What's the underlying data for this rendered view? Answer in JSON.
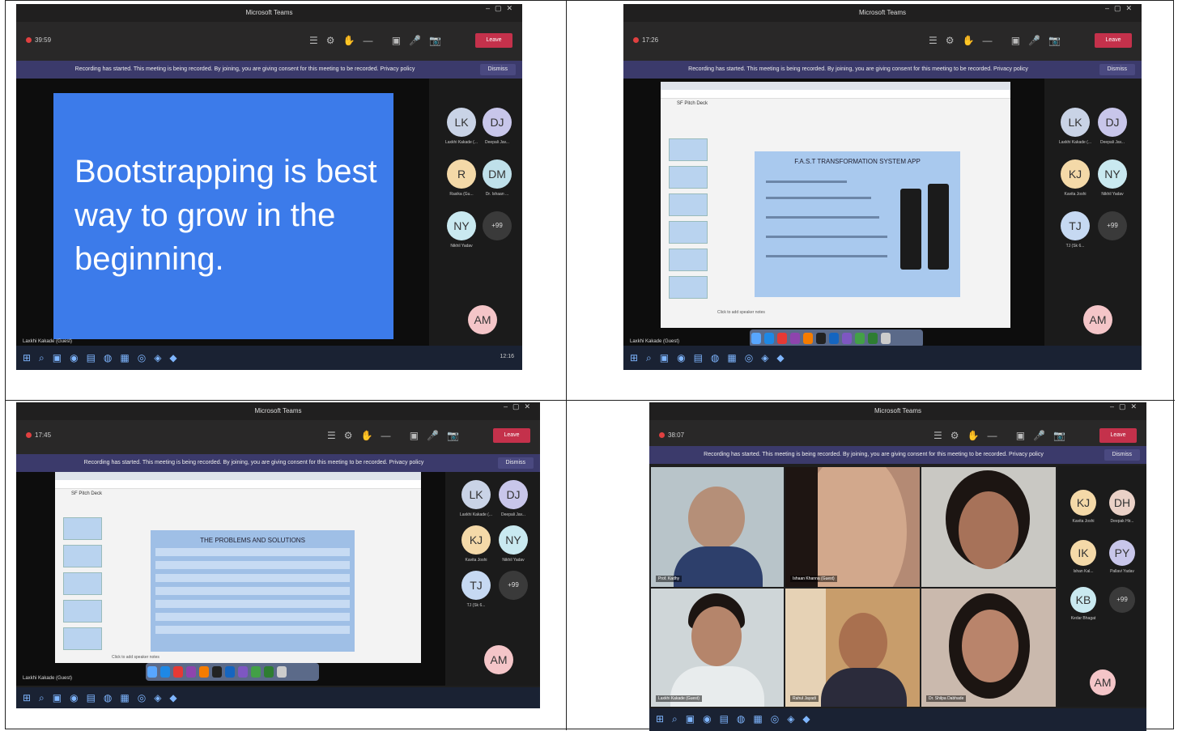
{
  "window": {
    "title": "Microsoft Teams",
    "leave_label": "Leave",
    "dismiss_label": "Dismiss",
    "banner_text": "Recording has started. This meeting is being recorded. By joining, you are giving consent for this meeting to be recorded. Privacy policy"
  },
  "shot1": {
    "timer": "39:59",
    "slide_text": "Bootstrapping is best way to grow in the beginning.",
    "presenter": "Laxkhi Kakade (Guest)",
    "tray_time": "12:16",
    "avatars": [
      {
        "initials": "LK",
        "label": "Laxkhi Kakade (...",
        "color": "#c9d3e6"
      },
      {
        "initials": "DJ",
        "label": "Deepali Jav...",
        "color": "#c8c6ea"
      },
      {
        "initials": "R",
        "label": "Rasika (Gu...",
        "color": "#f4d9a8"
      },
      {
        "initials": "DM",
        "label": "Dr. Ishaan ...",
        "color": "#bfe0ea"
      },
      {
        "initials": "NY",
        "label": "Nikhil Yadav",
        "color": "#c9e9f0"
      },
      {
        "initials": "+99",
        "label": "",
        "color": "#3a3a3a"
      },
      {
        "initials": "AM",
        "label": "",
        "color": "#f4c5c8"
      }
    ]
  },
  "shot2": {
    "timer": "17:26",
    "doc_title": "SF Pitch Deck",
    "slide_title": "F.A.S.T TRANSFORMATION SYSTEM APP",
    "speaker_notes": "Click to add speaker notes",
    "presenter": "Laxkhi Kakade (Guest)",
    "avatars": [
      {
        "initials": "LK",
        "label": "Laxkhi Kakade (...",
        "color": "#c9d3e6"
      },
      {
        "initials": "DJ",
        "label": "Deepali Jav...",
        "color": "#c8c6ea"
      },
      {
        "initials": "KJ",
        "label": "Kavita Joshi",
        "color": "#f4d9a8"
      },
      {
        "initials": "NY",
        "label": "Nikhil Yadav",
        "color": "#c9e9f0"
      },
      {
        "initials": "TJ",
        "label": "TJ (Sk 6...",
        "color": "#c6d9f2"
      },
      {
        "initials": "+99",
        "label": "",
        "color": "#3a3a3a"
      },
      {
        "initials": "AM",
        "label": "",
        "color": "#f4c5c8"
      }
    ]
  },
  "shot3": {
    "timer": "17:45",
    "doc_title": "SF Pitch Deck",
    "slide_title": "THE PROBLEMS AND SOLUTIONS",
    "speaker_notes": "Click to add speaker notes",
    "presenter": "Laxkhi Kakade (Guest)",
    "avatars": [
      {
        "initials": "LK",
        "label": "Laxkhi Kakade (...",
        "color": "#c9d3e6"
      },
      {
        "initials": "DJ",
        "label": "Deepali Jav...",
        "color": "#c8c6ea"
      },
      {
        "initials": "KJ",
        "label": "Kavita Joshi",
        "color": "#f4d9a8"
      },
      {
        "initials": "NY",
        "label": "Nikhil Yadav",
        "color": "#c9e9f0"
      },
      {
        "initials": "TJ",
        "label": "TJ (Sk 6...",
        "color": "#c6d9f2"
      },
      {
        "initials": "+99",
        "label": "",
        "color": "#3a3a3a"
      },
      {
        "initials": "AM",
        "label": "",
        "color": "#f4c5c8"
      }
    ]
  },
  "shot4": {
    "timer": "38:07",
    "avatars": [
      {
        "initials": "KJ",
        "label": "Kavita Joshi",
        "color": "#f4d9a8"
      },
      {
        "initials": "DH",
        "label": "Deepak Hir...",
        "color": "#ead1c7"
      },
      {
        "initials": "IK",
        "label": "Ishan Kal...",
        "color": "#f4d9a8"
      },
      {
        "initials": "PY",
        "label": "Pallavi Yadav",
        "color": "#c8c6ea"
      },
      {
        "initials": "KB",
        "label": "Kedar Bhagat",
        "color": "#c9e9f0"
      },
      {
        "initials": "+99",
        "label": "",
        "color": "#3a3a3a"
      },
      {
        "initials": "AM",
        "label": "",
        "color": "#f4c5c8"
      }
    ],
    "videos": [
      {
        "name": "Prof. Kadhy",
        "bg": "#b8c4c9"
      },
      {
        "name": "Ishaan Khanna (Guest)",
        "bg": "#b48a74"
      },
      {
        "name": "",
        "bg": "#c9c8c3"
      },
      {
        "name": "Laxkhi Kakade (Guest)",
        "bg": "#cfd6d8"
      },
      {
        "name": "Rahul Jayadi",
        "bg": "#c89d6b"
      },
      {
        "name": "Dr. Shilpa Dabhade",
        "bg": "#cab9ad"
      }
    ]
  }
}
